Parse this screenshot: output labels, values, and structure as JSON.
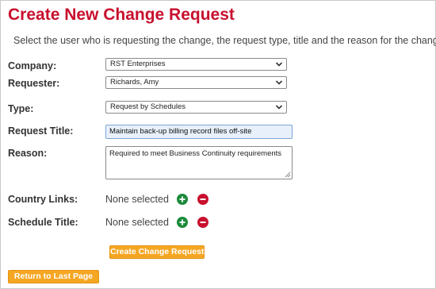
{
  "page": {
    "title": "Create New Change Request",
    "subtitle": "Select the user who is requesting the change, the request type, title and the reason for the change."
  },
  "form": {
    "company": {
      "label": "Company:",
      "value": "RST Enterprises",
      "icon": "chevron-down-icon"
    },
    "requester": {
      "label": "Requester:",
      "value": "Richards, Amy",
      "icon": "chevron-down-icon"
    },
    "type": {
      "label": "Type:",
      "value": "Request by Schedules",
      "icon": "chevron-down-icon"
    },
    "request_title": {
      "label": "Request Title:",
      "value": "Maintain back-up billing record files off-site"
    },
    "reason": {
      "label": "Reason:",
      "value": "Required to meet Business Continuity requirements"
    },
    "country_links": {
      "label": "Country Links:",
      "value": "None selected",
      "add_icon": "plus-circle-icon",
      "remove_icon": "minus-circle-icon"
    },
    "schedule_title": {
      "label": "Schedule Title:",
      "value": "None selected",
      "add_icon": "plus-circle-icon",
      "remove_icon": "minus-circle-icon"
    }
  },
  "buttons": {
    "create": "Create Change Request",
    "return": "Return to Last Page"
  },
  "colors": {
    "title": "#c8102e",
    "button": "#f5a623",
    "add": "#1a8a3a",
    "remove": "#c8102e",
    "input_focus_bg": "#e8f0fb"
  }
}
